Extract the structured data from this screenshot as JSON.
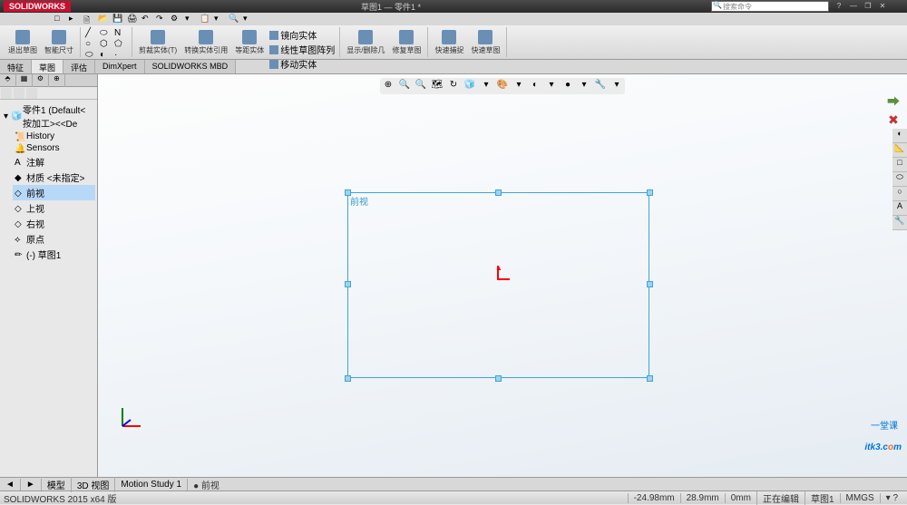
{
  "title": "草图1 — 零件1 *",
  "app_name": "SOLIDWORKS",
  "search_placeholder": "搜索命令",
  "window_buttons": {
    "help": "?",
    "min": "—",
    "restore": "❐",
    "close": "✕"
  },
  "qat": [
    "□",
    "▸",
    "🗎",
    "📂",
    "💾",
    "🖨",
    "↶",
    "↷",
    "⚙",
    "▾",
    "📋",
    "▾",
    "🔍",
    "▾"
  ],
  "ribbon": {
    "groups": [
      {
        "big": [
          {
            "label": "退出草图"
          },
          {
            "label": "智能尺寸"
          }
        ]
      },
      {
        "small": [
          [
            "╱",
            "⬭",
            "N"
          ],
          [
            "○",
            "⬡",
            "⬠"
          ],
          [
            "⬭",
            "◐",
            "·"
          ]
        ]
      },
      {
        "big": [
          {
            "label": "剪裁实体(T)"
          },
          {
            "label": "转换实体引用"
          },
          {
            "label": "等距实体"
          }
        ],
        "small_right": [
          {
            "label": "镜向实体"
          },
          {
            "label": "线性草图阵列"
          },
          {
            "label": "移动实体"
          }
        ]
      },
      {
        "big": [
          {
            "label": "显示/删除几"
          },
          {
            "label": "修复草图"
          }
        ]
      },
      {
        "big": [
          {
            "label": "快速捕捉"
          },
          {
            "label": "快速草图"
          }
        ]
      }
    ]
  },
  "tabs": [
    "特征",
    "草图",
    "评估",
    "DimXpert",
    "SOLIDWORKS MBD"
  ],
  "active_tab": 1,
  "tree": {
    "root": "零件1 (Default<按加工><<De",
    "items": [
      {
        "icon": "📜",
        "label": "History"
      },
      {
        "icon": "🔔",
        "label": "Sensors"
      },
      {
        "icon": "A",
        "label": "注解"
      },
      {
        "icon": "◆",
        "label": "材质 <未指定>"
      },
      {
        "icon": "◇",
        "label": "前视",
        "sel": true
      },
      {
        "icon": "◇",
        "label": "上视"
      },
      {
        "icon": "◇",
        "label": "右视"
      },
      {
        "icon": "⟡",
        "label": "原点"
      },
      {
        "icon": "✏",
        "label": "(-) 草图1"
      }
    ]
  },
  "view_toolbar": [
    "⊕",
    "🔍",
    "🔍",
    "🗺",
    "↻",
    "🧊",
    "▾",
    "🎨",
    "▾",
    "◐",
    "▾",
    "●",
    "▾",
    "🔧",
    "▾"
  ],
  "sketch_plane_label": "前视",
  "confirm": {
    "ok": "✔",
    "cancel": "✖"
  },
  "right_toolbar": [
    "◐",
    "📐",
    "□",
    "⬭",
    "○",
    "A",
    "🔧"
  ],
  "bottom_tabs": {
    "nav": [
      "◄",
      "►"
    ],
    "tabs": [
      "模型",
      "3D 视图",
      "Motion Study 1"
    ],
    "info": "● 前视"
  },
  "statusbar": {
    "left": "SOLIDWORKS 2015 x64 版",
    "coords": "-24.98mm",
    "coord2": "28.9mm",
    "coord3": "0mm",
    "state": "正在编辑",
    "doc": "草图1",
    "unit": "MMGS",
    "extra": "▾ ?"
  },
  "watermark": {
    "text1": "itk3",
    "text2": ".c",
    "text3": "o",
    "text4": "m",
    "sub": "一堂课"
  }
}
